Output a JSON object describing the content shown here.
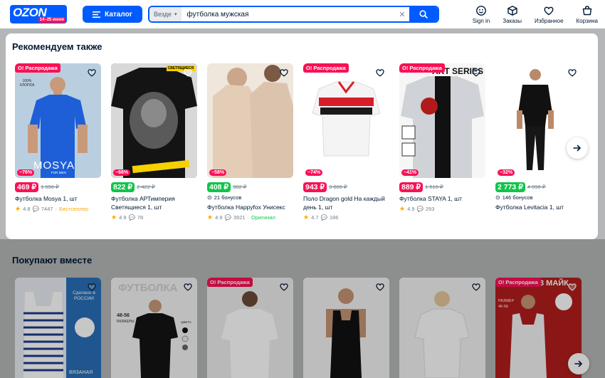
{
  "header": {
    "logo_text": "OZON",
    "logo_promo": "14–25 июня",
    "catalog_label": "Каталог",
    "search_scope": "Везде",
    "search_query": "футболка мужская",
    "nav": [
      {
        "label": "Sign in",
        "icon": "smile-icon"
      },
      {
        "label": "Заказы",
        "icon": "box-icon"
      },
      {
        "label": "Избранное",
        "icon": "heart-icon"
      },
      {
        "label": "Корзина",
        "icon": "cart-icon"
      }
    ]
  },
  "modal": {
    "title": "Рекомендуем также",
    "products": [
      {
        "badge": "О! Распродажа",
        "discount": "−76%",
        "price": "469 ₽",
        "price_color": "red",
        "old_price": "1 990 ₽",
        "title": "Футболка Mosya 1, шт",
        "rating": "4.8",
        "reviews": "7447",
        "tag": "Бестселлер",
        "bonus": ""
      },
      {
        "badge": "",
        "discount": "−66%",
        "price": "822 ₽",
        "price_color": "green",
        "old_price": "2 422 ₽",
        "title": "Футболка АРТимперия Светящиеся 1, шт",
        "rating": "4.9",
        "reviews": "78",
        "tag": "",
        "bonus": ""
      },
      {
        "badge": "",
        "discount": "−58%",
        "price": "408 ₽",
        "price_color": "green",
        "old_price": "982 ₽",
        "title": "Футболка Happyfox Унисекс",
        "rating": "4.9",
        "reviews": "3921",
        "tag": "Оригинал",
        "bonus": "21 бонусов"
      },
      {
        "badge": "О! Распродажа",
        "discount": "−74%",
        "price": "943 ₽",
        "price_color": "red",
        "old_price": "3 606 ₽",
        "title": "Поло Dragon gold На каждый день 1, шт",
        "rating": "4.7",
        "reviews": "186",
        "tag": "",
        "bonus": ""
      },
      {
        "badge": "О! Распродажа",
        "discount": "−41%",
        "price": "889 ₽",
        "price_color": "red",
        "old_price": "1 510 ₽",
        "title": "Футболка STAYA 1, шт",
        "rating": "4.9",
        "reviews": "293",
        "tag": "",
        "bonus": ""
      },
      {
        "badge": "",
        "discount": "−32%",
        "price": "2 773 ₽",
        "price_color": "green",
        "old_price": "4 098 ₽",
        "title": "Футболка Levitacia 1, шт",
        "rating": "",
        "reviews": "",
        "tag": "",
        "bonus": "146 бонусов"
      }
    ],
    "image_texts": {
      "mosya_brand": "MOSYA",
      "mosya_sub": "FOR MEN",
      "cotton": "100% ХЛОПОК",
      "glow": "СВЕТЯЩИЕСЯ",
      "staya": "ART SERIES"
    }
  },
  "section": {
    "title": "Покупают вместе",
    "badge": "О! Распродажа",
    "img_texts": {
      "made_in": "Сделано в РОССИИ",
      "knitted": "ВЯЗАНАЯ",
      "tshirt": "ФУТБОЛКА",
      "sizes": "48-56",
      "size_word": "РАЗМЕРЫ",
      "colors": "ЦВЕТА",
      "three": "3 МАЙК",
      "size_label": "РАЗМЕР",
      "size_range": "46-56"
    }
  }
}
